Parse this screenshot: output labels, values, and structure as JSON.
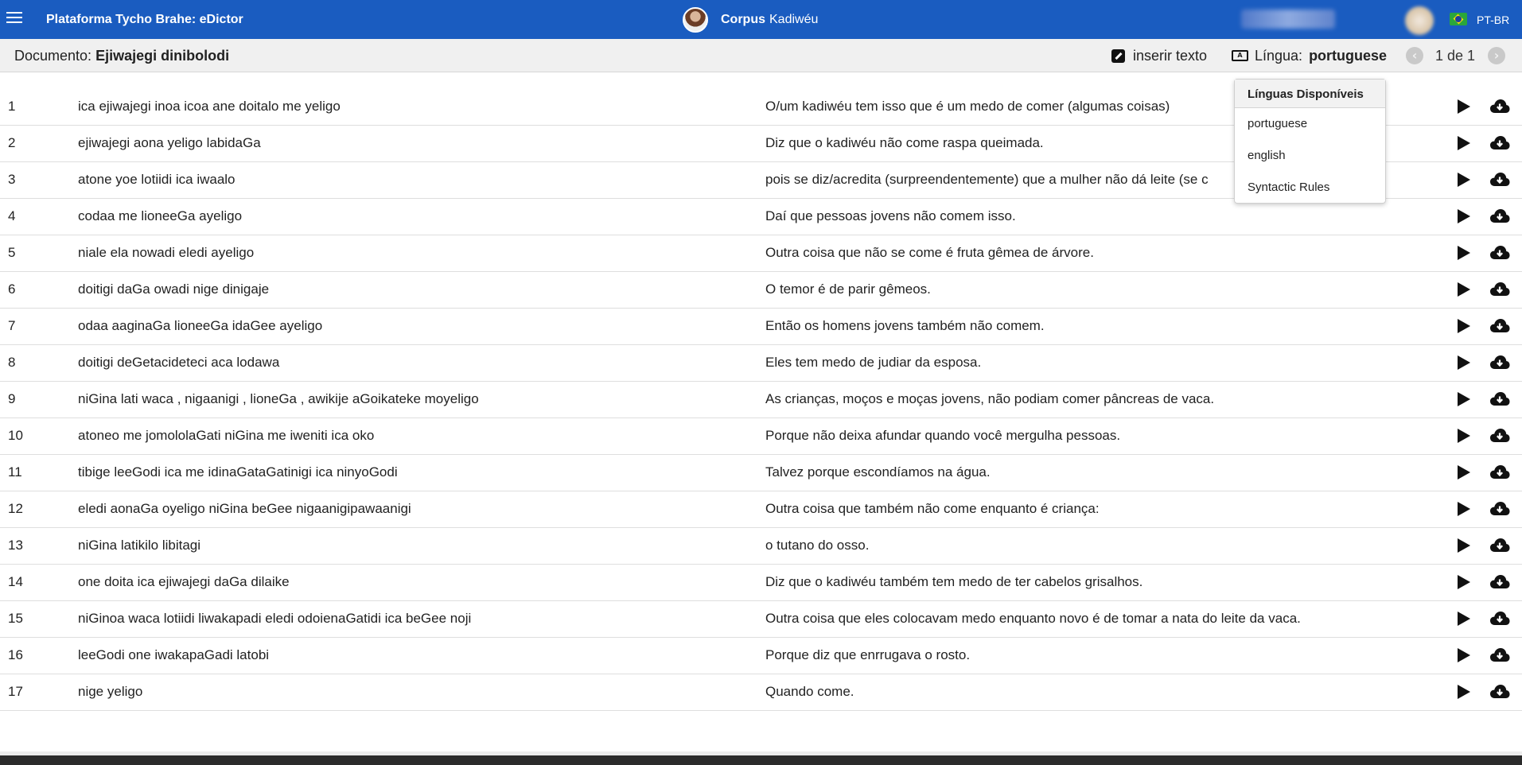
{
  "topbar": {
    "app_title": "Plataforma Tycho Brahe: eDictor",
    "corpus_label": "Corpus",
    "corpus_name": "Kadiwéu",
    "lang_code": "PT-BR"
  },
  "docbar": {
    "doc_label": "Documento:",
    "doc_name": "Ejiwajegi dinibolodi",
    "insert_label": "inserir texto",
    "language_label": "Língua:",
    "language_value": "portuguese",
    "prev_icon": "‹",
    "next_icon": "›",
    "page_indicator": "1 de 1"
  },
  "dropdown": {
    "header": "Línguas Disponíveis",
    "options": [
      "portuguese",
      "english",
      "Syntactic Rules"
    ]
  },
  "rows": [
    {
      "n": "1",
      "orig": "ica ejiwajegi inoa icoa ane doitalo me yeligo",
      "trans": "O/um kadiwéu tem isso que é um medo de comer (algumas coisas)"
    },
    {
      "n": "2",
      "orig": "ejiwajegi aona yeligo labidaGa",
      "trans": "Diz que o kadiwéu não come raspa queimada."
    },
    {
      "n": "3",
      "orig": "atone yoe lotiidi ica iwaalo",
      "trans": "pois se diz/acredita (surpreendentemente) que a mulher não dá leite (se c"
    },
    {
      "n": "4",
      "orig": "codaa me lioneeGa ayeligo",
      "trans": "Daí que pessoas jovens não comem isso."
    },
    {
      "n": "5",
      "orig": "niale ela nowadi eledi ayeligo",
      "trans": "Outra coisa que não se come é fruta gêmea de árvore."
    },
    {
      "n": "6",
      "orig": "doitigi daGa owadi nige dinigaje",
      "trans": "O temor é de parir gêmeos."
    },
    {
      "n": "7",
      "orig": "odaa aaginaGa lioneeGa idaGee ayeligo",
      "trans": "Então os homens jovens também não comem."
    },
    {
      "n": "8",
      "orig": "doitigi deGetacideteci aca lodawa",
      "trans": "Eles tem medo de judiar da esposa."
    },
    {
      "n": "9",
      "orig": "niGina lati waca , nigaanigi , lioneGa , awikije aGoikateke moyeligo",
      "trans": "As crianças, moços e moças jovens, não podiam comer pâncreas de vaca."
    },
    {
      "n": "10",
      "orig": "atoneo me jomololaGati niGina me iweniti ica oko",
      "trans": "Porque não deixa afundar quando você mergulha pessoas."
    },
    {
      "n": "11",
      "orig": "tibige leeGodi ica me idinaGataGatinigi ica ninyoGodi",
      "trans": "Talvez porque escondíamos na água."
    },
    {
      "n": "12",
      "orig": "eledi aonaGa oyeligo niGina beGee nigaanigipawaanigi",
      "trans": "Outra coisa que também não come enquanto é criança:"
    },
    {
      "n": "13",
      "orig": "niGina latikilo libitagi",
      "trans": "o tutano do osso."
    },
    {
      "n": "14",
      "orig": "one doita ica ejiwajegi daGa dilaike",
      "trans": "Diz que o kadiwéu também tem medo de ter cabelos grisalhos."
    },
    {
      "n": "15",
      "orig": "niGinoa waca lotiidi liwakapadi eledi odoienaGatidi ica beGee noji",
      "trans": "Outra coisa que eles colocavam medo enquanto novo é de tomar a nata do leite da vaca."
    },
    {
      "n": "16",
      "orig": "leeGodi one iwakapaGadi latobi",
      "trans": "Porque diz que enrrugava o rosto."
    },
    {
      "n": "17",
      "orig": "nige yeligo",
      "trans": "Quando come."
    }
  ],
  "icons": {
    "menu": "hamburger-icon",
    "insert": "pen-square-icon",
    "language": "language-icon",
    "play": "play-icon",
    "download": "cloud-download-icon"
  },
  "colors": {
    "topbar": "#1a5cc0",
    "docbar": "#f0f0f0"
  }
}
